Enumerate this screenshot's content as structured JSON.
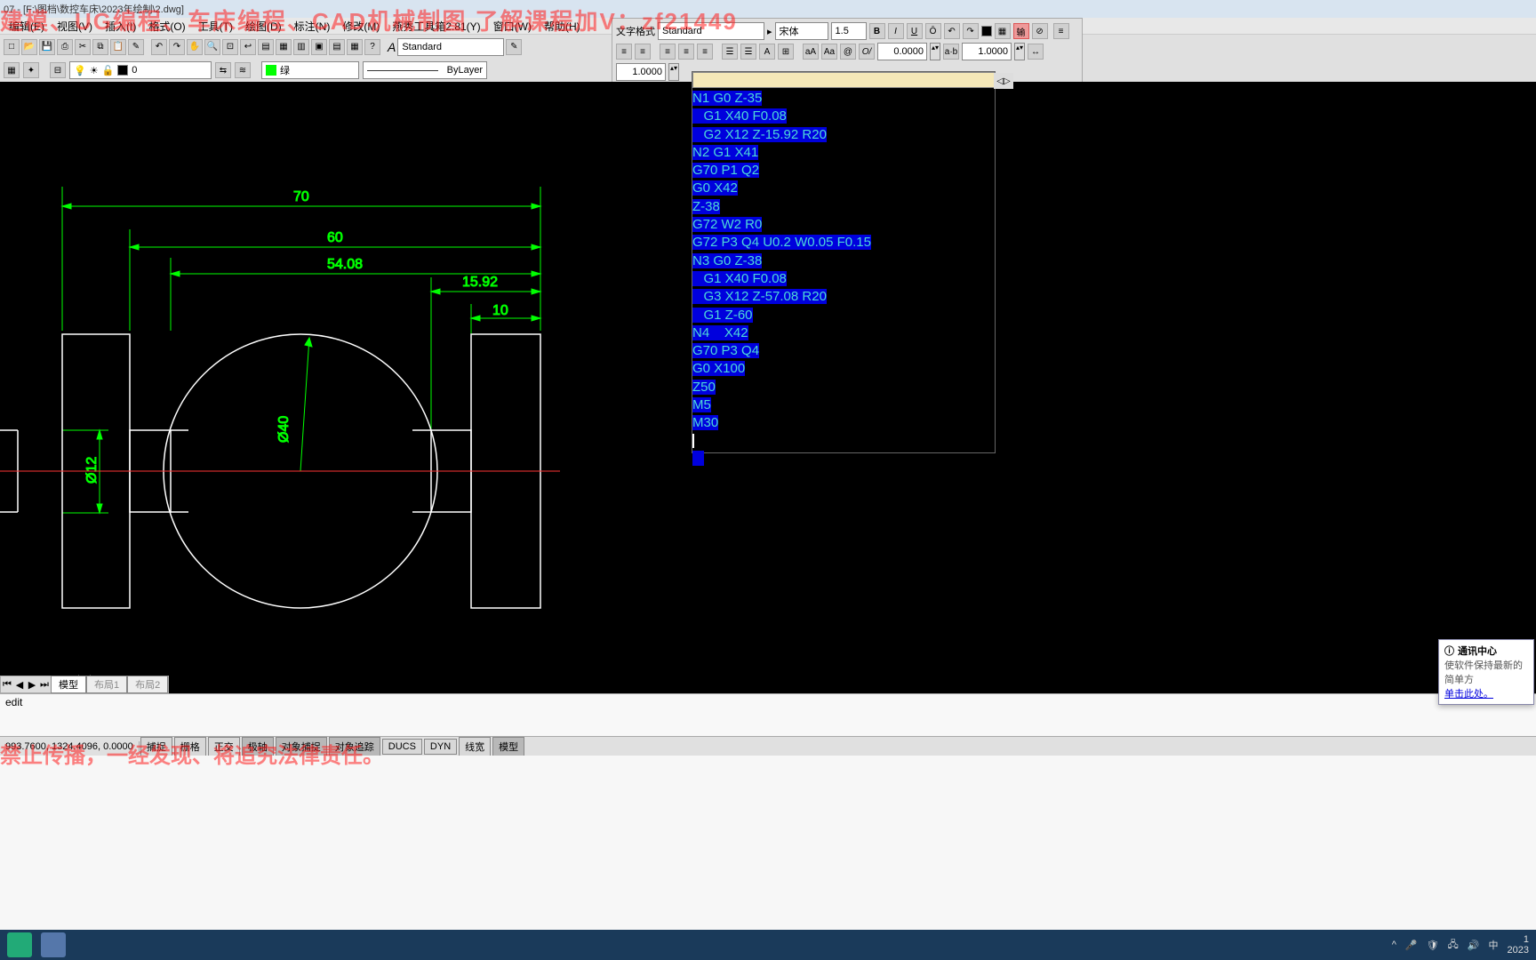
{
  "title": "07 - [F:\\图档\\数控车床\\2023年绘制\\2.dwg]",
  "menu": [
    "编辑(E)",
    "视图(V)",
    "插入(I)",
    "格式(O)",
    "工具(T)",
    "绘图(D)",
    "标注(N)",
    "修改(M)",
    "燕秀工具箱2.81(Y)",
    "窗口(W)",
    "帮助(H)"
  ],
  "toolbar1": {
    "text_style_label": "文字格式",
    "style1": "Standard",
    "style2": "Standard",
    "font": "宋体",
    "height": "1.5"
  },
  "layers": {
    "current_name": "0",
    "color_name": "绿",
    "linetype": "ByLayer"
  },
  "text_props": {
    "spacing": "0.0000",
    "width1": "1.0000",
    "width2": "1.0000"
  },
  "dims": {
    "d70": "70",
    "d60": "60",
    "d5408": "54.08",
    "d1592": "15.92",
    "d10": "10",
    "d40": "Ø40",
    "d12": "Ø12"
  },
  "gcode": [
    "N1 G0 Z-35",
    "   G1 X40 F0.08",
    "   G2 X12 Z-15.92 R20",
    "N2 G1 X41",
    "G70 P1 Q2",
    "G0 X42",
    "Z-38",
    "G72 W2 R0",
    "G72 P3 Q4 U0.2 W0.05 F0.15",
    "N3 G0 Z-38",
    "   G1 X40 F0.08",
    "   G3 X12 Z-57.08 R20",
    "   G1 Z-60",
    "N4    X42",
    "G70 P3 Q4",
    "G0 X100",
    "Z50",
    "M5",
    "M30"
  ],
  "tabs": {
    "active": "模型",
    "others": [
      "布局1",
      "布局2"
    ]
  },
  "cmd": {
    "line1": "edit"
  },
  "status": {
    "coords": "993.7600, 1324.4096, 0.0000",
    "buttons": [
      "捕捉",
      "栅格",
      "正交",
      "极轴",
      "对象捕捉",
      "对象追踪",
      "DUCS",
      "DYN",
      "线宽",
      "模型"
    ]
  },
  "overlay1": "建模、UG编程、车床编程、CAD机械制图    了解课程加V：zf21449",
  "overlay2": "禁止传播，一经发现、将追究法律责任。",
  "notif": {
    "title": "通讯中心",
    "body": "使软件保持最新的简单方",
    "link": "单击此处。"
  },
  "tray": {
    "ime": "中",
    "time": "1",
    "date": "2023"
  }
}
